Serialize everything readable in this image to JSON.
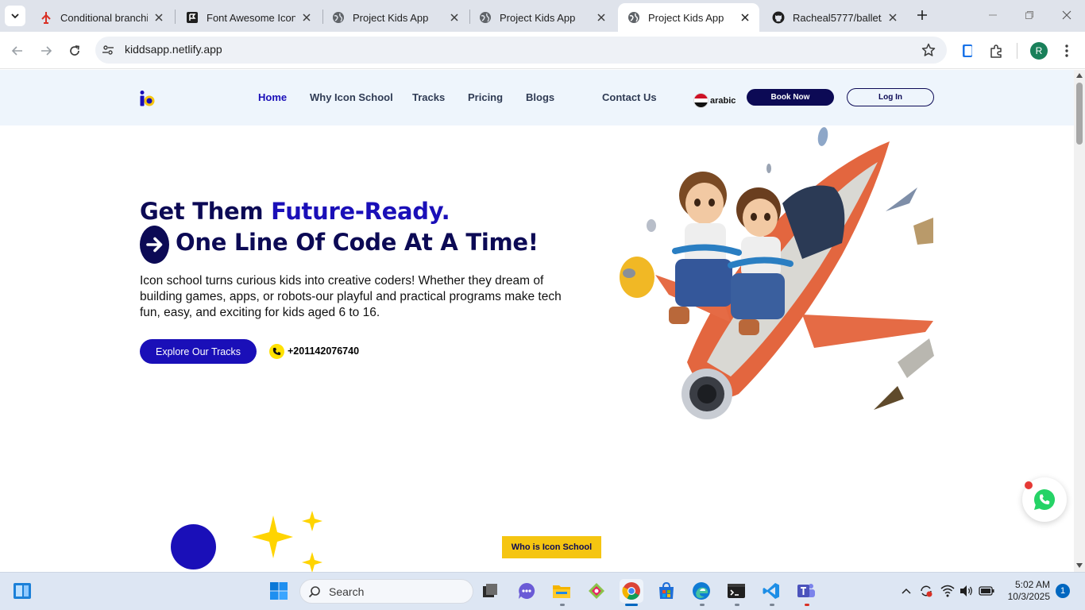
{
  "browser": {
    "tabs": [
      {
        "title": "Conditional branching",
        "favicon": "tree-branch-icon",
        "active": false
      },
      {
        "title": "Font Awesome Icons",
        "favicon": "flag-icon",
        "active": false
      },
      {
        "title": "Project Kids App",
        "favicon": "globe-icon",
        "active": false
      },
      {
        "title": "Project Kids App",
        "favicon": "globe-icon",
        "active": false
      },
      {
        "title": "Project Kids App",
        "favicon": "globe-icon",
        "active": true
      },
      {
        "title": "Racheal5777/balletApp",
        "favicon": "github-icon",
        "active": false
      }
    ],
    "url": "kiddsapp.netlify.app",
    "profile_initial": "R"
  },
  "site": {
    "nav": {
      "links": [
        "Home",
        "Why Icon School",
        "Tracks",
        "Pricing",
        "Blogs",
        "Contact Us"
      ],
      "active": "Home",
      "language": "arabic",
      "book_label": "Book Now",
      "login_label": "Log In"
    },
    "hero": {
      "headline_part1": "Get Them ",
      "headline_accent": "Future-Ready.",
      "headline_line2": "One Line Of Code At A Time!",
      "description": "Icon school turns curious kids into creative coders! Whether they dream of building games, apps, or robots-our playful and practical programs make tech fun, easy, and exciting for kids aged 6 to 16.",
      "cta_label": "Explore Our Tracks",
      "phone": "+201142076740"
    },
    "section_badge": "Who is Icon School"
  },
  "taskbar": {
    "search_placeholder": "Search",
    "time": "5:02 AM",
    "date": "10/3/2025",
    "notification_count": "1"
  },
  "colors": {
    "brand_dark": "#0c0a55",
    "brand_blue": "#1a0fb8",
    "accent_yellow": "#f5c511",
    "nav_bg": "#eef5fc"
  }
}
